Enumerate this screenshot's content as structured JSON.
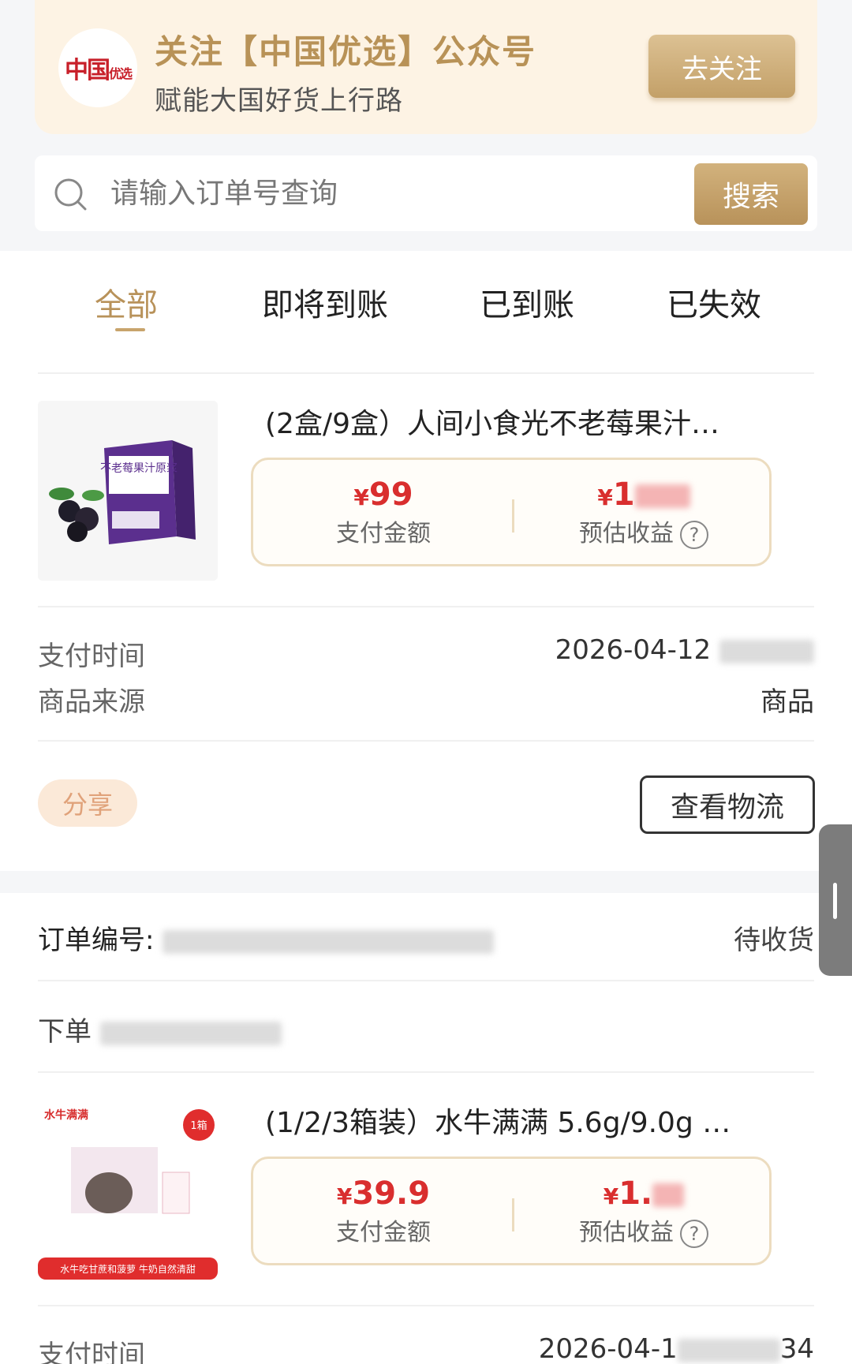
{
  "banner": {
    "logo_text": "中国",
    "logo_small": "优选",
    "title": "关注【中国优选】公众号",
    "subtitle": "赋能大国好货上行路",
    "follow_label": "去关注"
  },
  "search": {
    "placeholder": "请输入订单号查询",
    "button_label": "搜索"
  },
  "tabs": [
    {
      "label": "全部",
      "active": true
    },
    {
      "label": "即将到账",
      "active": false
    },
    {
      "label": "已到账",
      "active": false
    },
    {
      "label": "已失效",
      "active": false
    }
  ],
  "orders": [
    {
      "title": "(2盒/9盒）人间小食光不老莓果汁…",
      "pay_amount": "99",
      "pay_amount_label": "支付金额",
      "est_income": "1",
      "est_income_label": "预估收益",
      "pay_time_label": "支付时间",
      "pay_time": "2026-04-12",
      "source_label": "商品来源",
      "source": "商品",
      "share_label": "分享",
      "logistics_label": "查看物流",
      "thumb_text": "不老莓果汁原浆"
    },
    {
      "order_no_label": "订单编号:",
      "status": "待收货",
      "order_time_label": "下单",
      "title": "(1/2/3箱装）水牛满满 5.6g/9.0g …",
      "pay_amount": "39.9",
      "pay_amount_label": "支付金额",
      "est_income": "1.",
      "est_income_label": "预估收益",
      "pay_time_label": "支付时间",
      "pay_time": "2026-04-1",
      "pay_time_tail": "34",
      "thumb_brand": "水牛满满",
      "thumb_badge": "1箱",
      "thumb_caption": "水牛吃甘蔗和菠萝 牛奶自然清甜"
    }
  ],
  "currency": "¥",
  "colors": {
    "gold": "#b8925a",
    "price_red": "#d92e2e",
    "banner_bg": "#fdf3e4"
  }
}
